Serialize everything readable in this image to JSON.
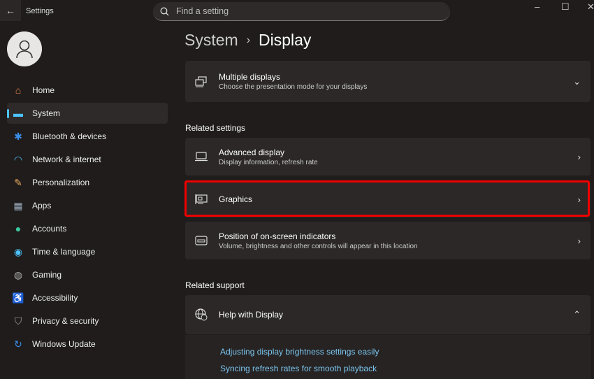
{
  "app": {
    "title": "Settings"
  },
  "search": {
    "placeholder": "Find a setting"
  },
  "window": {
    "minimize": "–",
    "maximize": "☐",
    "close": "✕"
  },
  "nav": [
    {
      "label": "Home",
      "icon": "home-icon",
      "color": "#e8884a"
    },
    {
      "label": "System",
      "icon": "system-icon",
      "color": "#4cc2ff",
      "selected": true
    },
    {
      "label": "Bluetooth & devices",
      "icon": "bluetooth-icon",
      "color": "#3b8eea"
    },
    {
      "label": "Network & internet",
      "icon": "wifi-icon",
      "color": "#4cc2ff"
    },
    {
      "label": "Personalization",
      "icon": "brush-icon",
      "color": "#e8a860"
    },
    {
      "label": "Apps",
      "icon": "apps-icon",
      "color": "#9ab"
    },
    {
      "label": "Accounts",
      "icon": "accounts-icon",
      "color": "#3cc8a0"
    },
    {
      "label": "Time & language",
      "icon": "globe-clock-icon",
      "color": "#4cc2ff"
    },
    {
      "label": "Gaming",
      "icon": "gamepad-icon",
      "color": "#aaa"
    },
    {
      "label": "Accessibility",
      "icon": "accessibility-icon",
      "color": "#4cc2ff"
    },
    {
      "label": "Privacy & security",
      "icon": "shield-icon",
      "color": "#aaa"
    },
    {
      "label": "Windows Update",
      "icon": "update-icon",
      "color": "#3b8eea"
    }
  ],
  "breadcrumb": {
    "parent": "System",
    "sep": "›",
    "current": "Display"
  },
  "cards": {
    "multiple": {
      "title": "Multiple displays",
      "sub": "Choose the presentation mode for your displays"
    },
    "advanced": {
      "title": "Advanced display",
      "sub": "Display information, refresh rate"
    },
    "graphics": {
      "title": "Graphics"
    },
    "position": {
      "title": "Position of on-screen indicators",
      "sub": "Volume, brightness and other controls will appear in this location"
    },
    "help": {
      "title": "Help with Display"
    }
  },
  "sections": {
    "related_settings": "Related settings",
    "related_support": "Related support"
  },
  "links": [
    "Adjusting display brightness settings easily",
    "Syncing refresh rates for smooth playback"
  ],
  "colors": {
    "highlight": "#e00000",
    "accent": "#4cc2ff",
    "link": "#7cc6f0"
  }
}
